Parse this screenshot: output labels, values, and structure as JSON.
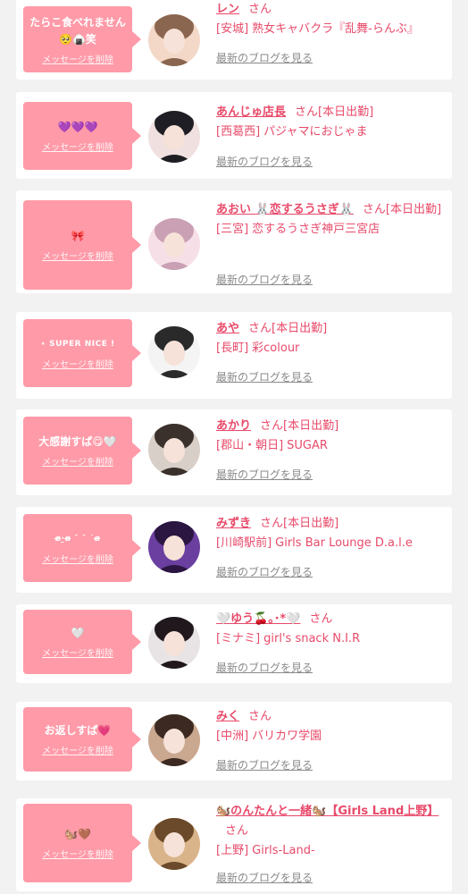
{
  "cards": [
    {
      "message": "たらこ食べれません🥺🍙笑",
      "delete_label": "メッセージを削除",
      "name": "レン",
      "san": "さん",
      "status": "",
      "area": "[安城]",
      "shop": "熟女キャバクラ『乱舞-らんぶ』",
      "blog_label": "最新のブログを見る",
      "avatar_colors": [
        "#f3d8c8",
        "#8a6650"
      ]
    },
    {
      "message": "💜💜💜",
      "delete_label": "メッセージを削除",
      "name": "あんじゅ店長",
      "san": "さん",
      "status": "[本日出勤]",
      "area": "[西葛西]",
      "shop": "パジャマにおじゃま",
      "blog_label": "最新のブログを見る",
      "avatar_colors": [
        "#f0e0e0",
        "#1e1e24"
      ]
    },
    {
      "message": "🎀",
      "delete_label": "メッセージを削除",
      "name": "あおい 🐰恋するうさぎ🐰",
      "san": "さん",
      "status": "[本日出勤]",
      "area": "[三宮]",
      "shop": "恋するうさぎ神戸三宮店",
      "blog_label": "最新のブログを見る",
      "avatar_colors": [
        "#f7dfe8",
        "#c9a0b4"
      ]
    },
    {
      "message": "⋆ SUPER NICE !",
      "delete_label": "メッセージを削除",
      "name": "あや",
      "san": "さん",
      "status": "[本日出勤]",
      "area": "[長町]",
      "shop": "彩colour",
      "blog_label": "最新のブログを見る",
      "avatar_colors": [
        "#f4f4f4",
        "#2a2a2a"
      ]
    },
    {
      "message": "大感謝すぱ😋🤍",
      "delete_label": "メッセージを削除",
      "name": "あかり",
      "san": "さん",
      "status": "[本日出勤]",
      "area": "[郡山・朝日]",
      "shop": "SUGAR",
      "blog_label": "最新のブログを見る",
      "avatar_colors": [
        "#d8cfc8",
        "#3a302c"
      ]
    },
    {
      "message": "ɞ̴̶̷·̫ɞ̴̶̷ ˉ ˉ ˙ɞ̴̶̷",
      "delete_label": "メッセージを削除",
      "name": "みずき",
      "san": "さん",
      "status": "[本日出勤]",
      "area": "[川崎駅前]",
      "shop": "Girls Bar Lounge D.a.l.e",
      "blog_label": "最新のブログを見る",
      "avatar_colors": [
        "#6b3fa0",
        "#2a1640"
      ]
    },
    {
      "message": "🤍",
      "delete_label": "メッセージを削除",
      "name": "🤍ゆう🍒｡･*🤍",
      "san": "さん",
      "status": "",
      "area": "[ミナミ]",
      "shop": "girl's snack N.I.R",
      "blog_label": "最新のブログを見る",
      "avatar_colors": [
        "#e8e4e6",
        "#20181c"
      ]
    },
    {
      "message": "お返しすぱ💗",
      "delete_label": "メッセージを削除",
      "name": "みく",
      "san": "さん",
      "status": "",
      "area": "[中洲]",
      "shop": "バリカワ学園",
      "blog_label": "最新のブログを見る",
      "avatar_colors": [
        "#caa890",
        "#3c2a22"
      ]
    },
    {
      "message": "🐿️🤎",
      "delete_label": "メッセージを削除",
      "name": "🐿️のんたんと一緒🐿️【Girls Land上野】",
      "san": "さん",
      "status": "",
      "area": "[上野]",
      "shop": "Girls-Land-",
      "blog_label": "最新のブログを見る",
      "avatar_colors": [
        "#d9b48a",
        "#6a4a2a"
      ]
    }
  ]
}
